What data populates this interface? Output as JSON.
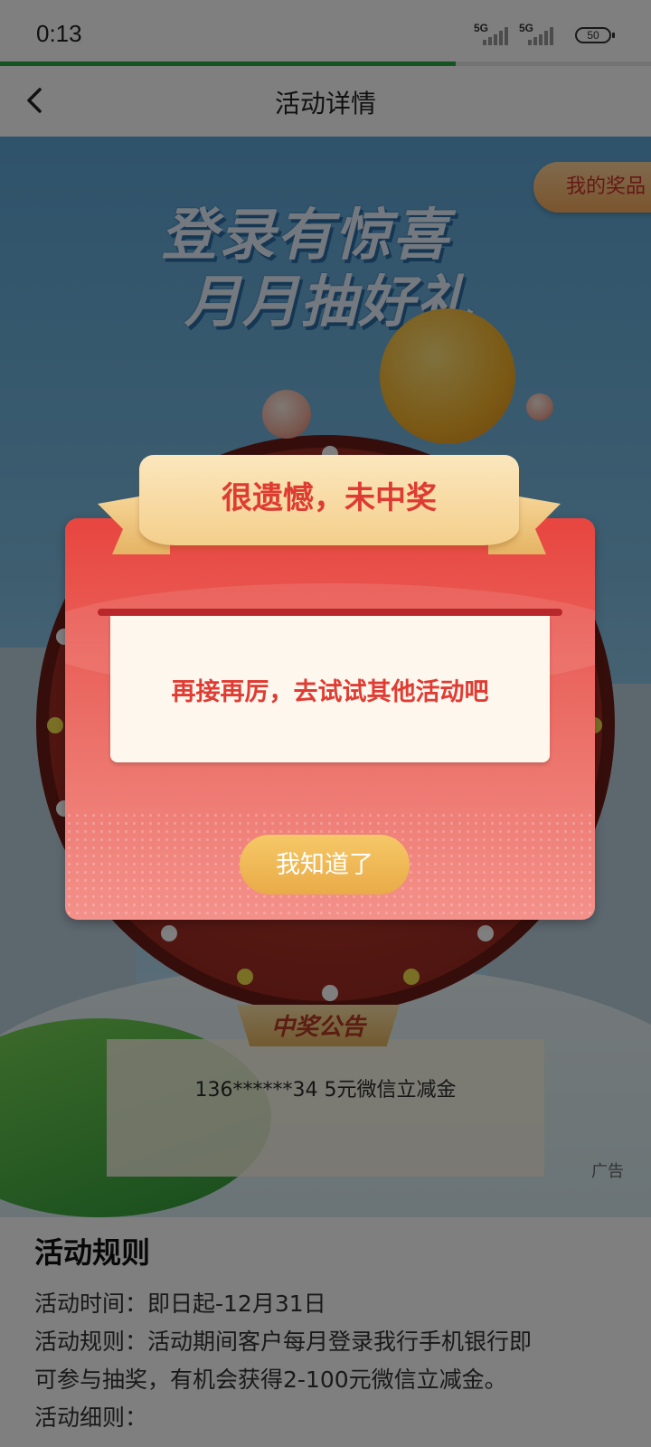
{
  "status_bar": {
    "time": "0:13",
    "signal_1": "5G",
    "signal_2": "5G",
    "battery": "50"
  },
  "page_load_progress": 0.7,
  "nav": {
    "back_icon": "chevron-left-icon",
    "title": "活动详情"
  },
  "banner": {
    "headline_line1": "登录有惊喜",
    "headline_line2": "月月抽好礼",
    "my_prize_button": "我的奖品",
    "notice_title": "中奖公告",
    "notice_text": "136******34 5元微信立减金",
    "ad_tag": "广告"
  },
  "rules": {
    "title": "活动规则",
    "lines": [
      "活动时间：即日起-12月31日",
      "活动规则：活动期间客户每月登录我行手机银行即",
      "可参与抽奖，有机会获得2-100元微信立减金。",
      "活动细则："
    ]
  },
  "popup": {
    "title": "很遗憾，未中奖",
    "message": "再接再厉，去试试其他活动吧",
    "ok_button": "我知道了"
  },
  "colors": {
    "progress": "#2aa845",
    "popup_red": "#e8453f",
    "ribbon_gold": "#f4cf8c",
    "button_gold": "#e9ab48"
  }
}
